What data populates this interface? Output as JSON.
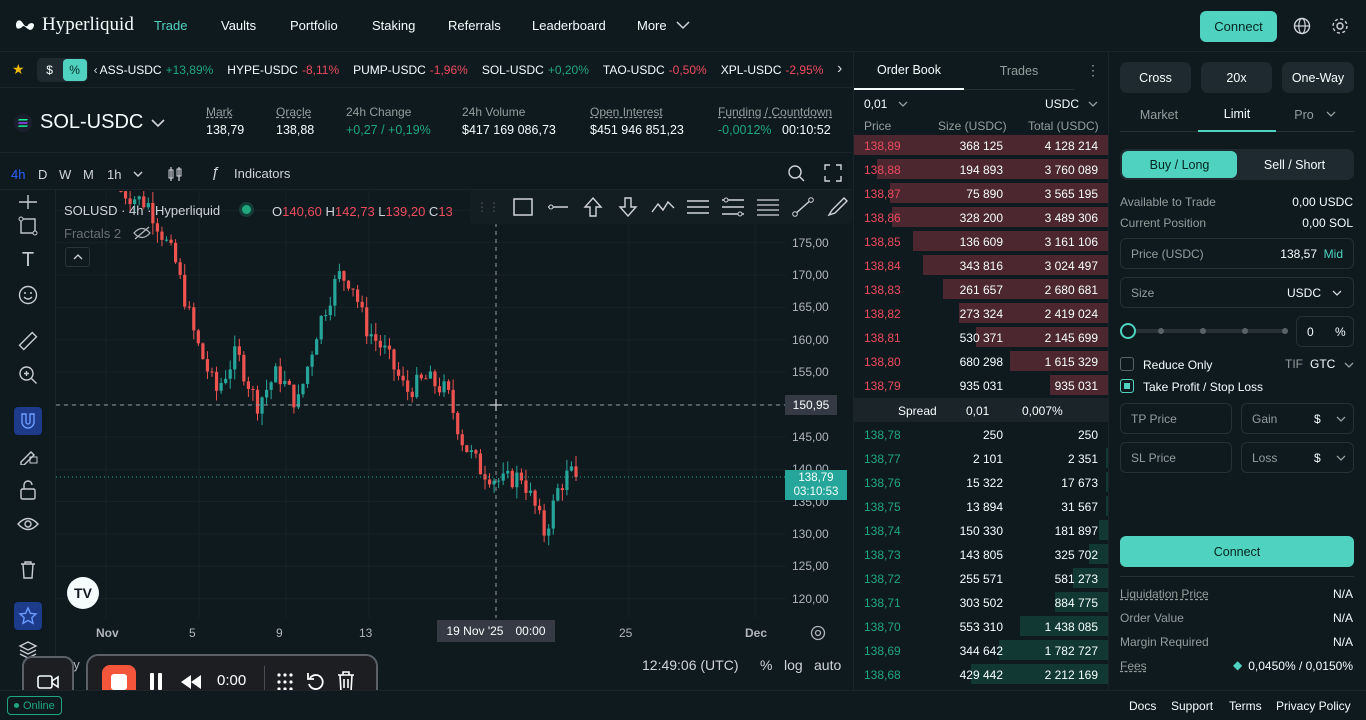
{
  "nav": {
    "brand": "Hyperliquid",
    "links": [
      "Trade",
      "Vaults",
      "Portfolio",
      "Staking",
      "Referrals",
      "Leaderboard",
      "More"
    ],
    "connect": "Connect"
  },
  "ticker": {
    "toggle_dollar": "$",
    "toggle_pct": "%",
    "items": [
      {
        "pair": "ASS-USDC",
        "chg": "+13,89%",
        "dir": "up"
      },
      {
        "pair": "HYPE-USDC",
        "chg": "-8,11%",
        "dir": "down"
      },
      {
        "pair": "PUMP-USDC",
        "chg": "-1,96%",
        "dir": "down"
      },
      {
        "pair": "SOL-USDC",
        "chg": "+0,20%",
        "dir": "up"
      },
      {
        "pair": "TAO-USDC",
        "chg": "-0,50%",
        "dir": "down"
      },
      {
        "pair": "XPL-USDC",
        "chg": "-2,95%",
        "dir": "down"
      }
    ]
  },
  "market": {
    "symbol": "SOL-USDC",
    "mark_label": "Mark",
    "mark": "138,79",
    "oracle_label": "Oracle",
    "oracle": "138,88",
    "chg_label": "24h Change",
    "chg": "+0,27 / +0,19%",
    "vol_label": "24h Volume",
    "vol": "$417 169 086,73",
    "oi_label": "Open Interest",
    "oi": "$451 946 851,23",
    "funding_label": "Funding / Countdown",
    "funding": "-0,0012%",
    "countdown": "00:10:52"
  },
  "chart_toolbar": {
    "intervals": [
      "4h",
      "D",
      "W",
      "M",
      "1h"
    ],
    "indicators": "Indicators"
  },
  "chart_legend": {
    "symbol": "SOLUSD · 4h · Hyperliquid",
    "o_label": "O",
    "o": "140,60",
    "h_label": "H",
    "h": "142,73",
    "l_label": "L",
    "l": "139,20",
    "c_label": "C",
    "c": "13",
    "indicator": "Fractals 2"
  },
  "chart": {
    "crosshair_price": "150,95",
    "last_price": "138,79",
    "last_countdown": "03:10:53",
    "crosshair_date": "19 Nov '25",
    "crosshair_time": "00:00",
    "clock": "12:49:06 (UTC)",
    "pct": "%",
    "log": "log",
    "auto": "auto",
    "by_partial": "by"
  },
  "chart_data": {
    "type": "candlestick",
    "y_ticks": [
      "180,00",
      "175,00",
      "170,00",
      "165,00",
      "160,00",
      "155,00",
      "150,00",
      "145,00",
      "140,00",
      "135,00",
      "130,00",
      "125,00",
      "120,00"
    ],
    "x_ticks": [
      "Nov",
      "5",
      "9",
      "13",
      "25",
      "Dec"
    ],
    "ylim": [
      117,
      183
    ],
    "last_close": 138.79
  },
  "recorder": {
    "time": "0:00"
  },
  "orderbook": {
    "tab_book": "Order Book",
    "tab_trades": "Trades",
    "tick": "0,01",
    "unit": "USDC",
    "col_price": "Price",
    "col_size": "Size (USDC)",
    "col_total": "Total (USDC)",
    "asks": [
      {
        "price": "138,89",
        "size": "368 125",
        "total": "4 128 214",
        "fill": 1.0
      },
      {
        "price": "138,88",
        "size": "194 893",
        "total": "3 760 089",
        "fill": 0.91
      },
      {
        "price": "138,87",
        "size": "75 890",
        "total": "3 565 195",
        "fill": 0.86
      },
      {
        "price": "138,86",
        "size": "328 200",
        "total": "3 489 306",
        "fill": 0.85
      },
      {
        "price": "138,85",
        "size": "136 609",
        "total": "3 161 106",
        "fill": 0.77
      },
      {
        "price": "138,84",
        "size": "343 816",
        "total": "3 024 497",
        "fill": 0.73
      },
      {
        "price": "138,83",
        "size": "261 657",
        "total": "2 680 681",
        "fill": 0.65
      },
      {
        "price": "138,82",
        "size": "273 324",
        "total": "2 419 024",
        "fill": 0.59
      },
      {
        "price": "138,81",
        "size": "530 371",
        "total": "2 145 699",
        "fill": 0.52
      },
      {
        "price": "138,80",
        "size": "680 298",
        "total": "1 615 329",
        "fill": 0.39
      },
      {
        "price": "138,79",
        "size": "935 031",
        "total": "935 031",
        "fill": 0.23
      }
    ],
    "spread_label": "Spread",
    "spread": "0,01",
    "spread_pct": "0,007%",
    "bids": [
      {
        "price": "138,78",
        "size": "250",
        "total": "250",
        "fill": 0.0
      },
      {
        "price": "138,77",
        "size": "2 101",
        "total": "2 351",
        "fill": 0.01
      },
      {
        "price": "138,76",
        "size": "15 322",
        "total": "17 673",
        "fill": 0.01
      },
      {
        "price": "138,75",
        "size": "13 894",
        "total": "31 567",
        "fill": 0.01
      },
      {
        "price": "138,74",
        "size": "150 330",
        "total": "181 897",
        "fill": 0.04
      },
      {
        "price": "138,73",
        "size": "143 805",
        "total": "325 702",
        "fill": 0.08
      },
      {
        "price": "138,72",
        "size": "255 571",
        "total": "581 273",
        "fill": 0.14
      },
      {
        "price": "138,71",
        "size": "303 502",
        "total": "884 775",
        "fill": 0.21
      },
      {
        "price": "138,70",
        "size": "553 310",
        "total": "1 438 085",
        "fill": 0.35
      },
      {
        "price": "138,69",
        "size": "344 642",
        "total": "1 782 727",
        "fill": 0.43
      },
      {
        "price": "138,68",
        "size": "429 442",
        "total": "2 212 169",
        "fill": 0.54
      }
    ]
  },
  "trade": {
    "margin_mode": "Cross",
    "leverage": "20x",
    "position_mode": "One-Way",
    "tab_market": "Market",
    "tab_limit": "Limit",
    "tab_pro": "Pro",
    "buy": "Buy / Long",
    "sell": "Sell / Short",
    "avail_label": "Available to Trade",
    "avail": "0,00 USDC",
    "pos_label": "Current Position",
    "pos": "0,00 SOL",
    "price_label": "Price (USDC)",
    "price": "138,57",
    "mid": "Mid",
    "size_label": "Size",
    "size_unit": "USDC",
    "pct_value": "0",
    "pct_sign": "%",
    "reduce_only": "Reduce Only",
    "tif_label": "TIF",
    "tif": "GTC",
    "tpsl": "Take Profit / Stop Loss",
    "tp_price": "TP Price",
    "gain": "Gain",
    "sl_price": "SL Price",
    "loss": "Loss",
    "dollar": "$",
    "connect": "Connect",
    "liq_label": "Liquidation Price",
    "liq": "N/A",
    "ov_label": "Order Value",
    "ov": "N/A",
    "mr_label": "Margin Required",
    "mr": "N/A",
    "fees_label": "Fees",
    "fees": "0,0450% / 0,0150%"
  },
  "footer": {
    "status": "Online",
    "links": [
      "Docs",
      "Support",
      "Terms",
      "Privacy Policy"
    ]
  },
  "colors": {
    "accent": "#50d2c1",
    "up": "#1fa67d",
    "down": "#ed4b5e",
    "bg": "#0f1a1f"
  }
}
